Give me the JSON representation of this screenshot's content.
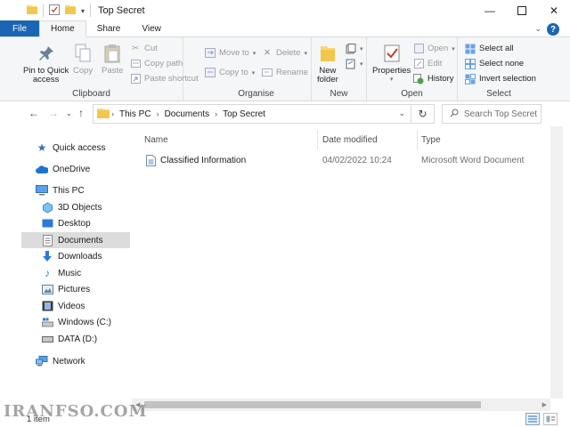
{
  "window": {
    "title": "Top Secret"
  },
  "tabs": [
    {
      "label": "File"
    },
    {
      "label": "Home"
    },
    {
      "label": "Share"
    },
    {
      "label": "View"
    }
  ],
  "help_label": "?",
  "ribbon": {
    "clipboard": {
      "label": "Clipboard",
      "pin_line1": "Pin to Quick",
      "pin_line2": "access",
      "copy": "Copy",
      "paste": "Paste",
      "cut": "Cut",
      "copy_path": "Copy path",
      "paste_shortcut": "Paste shortcut"
    },
    "organise": {
      "label": "Organise",
      "move_to": "Move to",
      "copy_to": "Copy to",
      "delete": "Delete",
      "rename": "Rename"
    },
    "new": {
      "label": "New",
      "new_line1": "New",
      "new_line2": "folder"
    },
    "open": {
      "label": "Open",
      "properties": "Properties",
      "open": "Open",
      "edit": "Edit",
      "history": "History"
    },
    "select": {
      "label": "Select",
      "select_all": "Select all",
      "select_none": "Select none",
      "invert": "Invert selection"
    }
  },
  "address": {
    "crumbs": [
      "This PC",
      "Documents",
      "Top Secret"
    ],
    "search_placeholder": "Search Top Secret"
  },
  "nav": {
    "items": [
      {
        "label": "Quick access"
      },
      {
        "label": "OneDrive"
      },
      {
        "label": "This PC"
      },
      {
        "label": "3D Objects"
      },
      {
        "label": "Desktop"
      },
      {
        "label": "Documents"
      },
      {
        "label": "Downloads"
      },
      {
        "label": "Music"
      },
      {
        "label": "Pictures"
      },
      {
        "label": "Videos"
      },
      {
        "label": "Windows (C:)"
      },
      {
        "label": "DATA (D:)"
      },
      {
        "label": "Network"
      }
    ]
  },
  "columns": {
    "name": "Name",
    "date": "Date modified",
    "type": "Type"
  },
  "files": [
    {
      "name": "Classified Information",
      "date": "04/02/2022 10:24",
      "type": "Microsoft Word Document"
    }
  ],
  "status": {
    "count": "1 item"
  },
  "watermark": "IRANFSO.COM",
  "colors": {
    "accent": "#1a66b3",
    "folder": "#f8d775",
    "selected_nav": "#dcdcdc"
  }
}
